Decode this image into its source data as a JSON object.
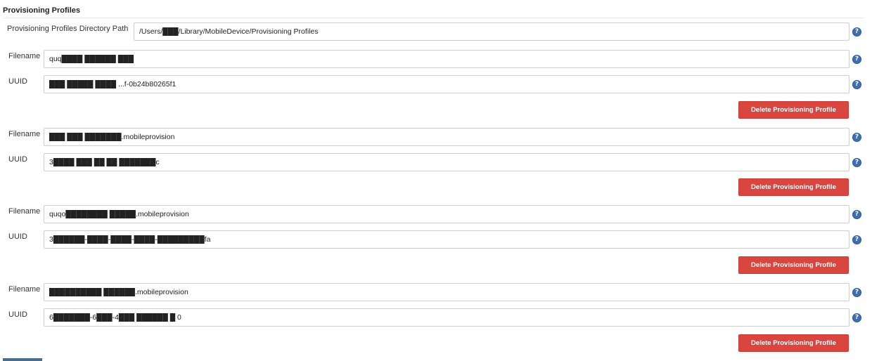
{
  "section": {
    "title": "Provisioning Profiles"
  },
  "directory": {
    "label": "Provisioning Profiles Directory Path",
    "value": "/Users/███/Library/MobileDevice/Provisioning Profiles"
  },
  "help_icon": {
    "glyph": "?"
  },
  "profiles": [
    {
      "filename_label": "Filename",
      "filename": "quq████ ██████ ███",
      "uuid_label": "UUID",
      "uuid": "███ █████ ████ ...f-0b24b80265f1",
      "delete_label": "Delete Provisioning Profile"
    },
    {
      "filename_label": "Filename",
      "filename": "███ ███ ███████.mobileprovision",
      "uuid_label": "UUID",
      "uuid": "3████ ███ ██ ██ ███████c",
      "delete_label": "Delete Provisioning Profile"
    },
    {
      "filename_label": "Filename",
      "filename": "quqo████████ █████.mobileprovision",
      "uuid_label": "UUID",
      "uuid": "3██████-████-████-████-█████████fa",
      "delete_label": "Delete Provisioning Profile"
    },
    {
      "filename_label": "Filename",
      "filename": "██████████ ██████.mobileprovision",
      "uuid_label": "UUID",
      "uuid": "6███████-6███-4███ ██████ █ 0",
      "delete_label": "Delete Provisioning Profile"
    }
  ]
}
